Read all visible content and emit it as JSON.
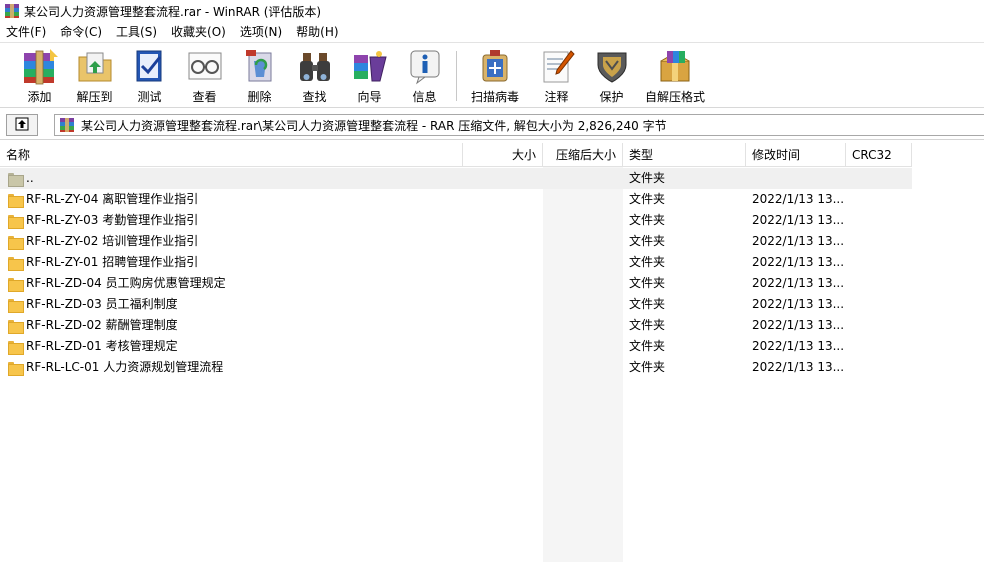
{
  "window": {
    "title": "某公司人力资源管理整套流程.rar - WinRAR (评估版本)"
  },
  "menu": [
    "文件(F)",
    "命令(C)",
    "工具(S)",
    "收藏夹(O)",
    "选项(N)",
    "帮助(H)"
  ],
  "toolbar": {
    "add": "添加",
    "extract_to": "解压到",
    "test": "测试",
    "view": "查看",
    "delete": "删除",
    "find": "查找",
    "wizard": "向导",
    "info": "信息",
    "virus_scan": "扫描病毒",
    "comment": "注释",
    "protect": "保护",
    "sfx": "自解压格式"
  },
  "address": {
    "path": "某公司人力资源管理整套流程.rar\\某公司人力资源管理整套流程 - RAR 压缩文件, 解包大小为 2,826,240 字节"
  },
  "columns": {
    "name": "名称",
    "size": "大小",
    "packed": "压缩后大小",
    "type": "类型",
    "modified": "修改时间",
    "crc": "CRC32"
  },
  "rows": [
    {
      "name": "..",
      "type": "文件夹",
      "modified": ""
    },
    {
      "name": "RF-RL-ZY-04 离职管理作业指引",
      "type": "文件夹",
      "modified": "2022/1/13 13..."
    },
    {
      "name": "RF-RL-ZY-03 考勤管理作业指引",
      "type": "文件夹",
      "modified": "2022/1/13 13..."
    },
    {
      "name": "RF-RL-ZY-02 培训管理作业指引",
      "type": "文件夹",
      "modified": "2022/1/13 13..."
    },
    {
      "name": "RF-RL-ZY-01 招聘管理作业指引",
      "type": "文件夹",
      "modified": "2022/1/13 13..."
    },
    {
      "name": "RF-RL-ZD-04 员工购房优惠管理规定",
      "type": "文件夹",
      "modified": "2022/1/13 13..."
    },
    {
      "name": "RF-RL-ZD-03 员工福利制度",
      "type": "文件夹",
      "modified": "2022/1/13 13..."
    },
    {
      "name": "RF-RL-ZD-02 薪酬管理制度",
      "type": "文件夹",
      "modified": "2022/1/13 13..."
    },
    {
      "name": "RF-RL-ZD-01 考核管理规定",
      "type": "文件夹",
      "modified": "2022/1/13 13..."
    },
    {
      "name": "RF-RL-LC-01 人力资源规划管理流程",
      "type": "文件夹",
      "modified": "2022/1/13 13..."
    }
  ]
}
